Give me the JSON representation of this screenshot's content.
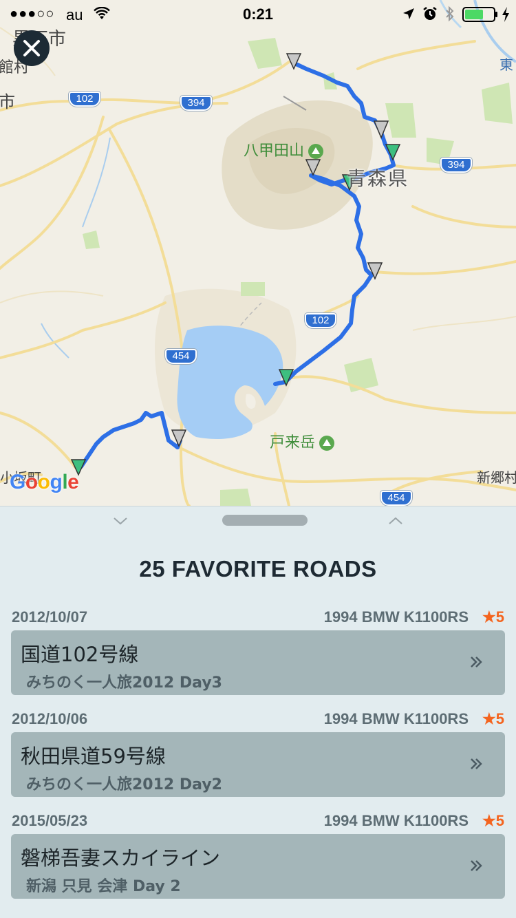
{
  "status_bar": {
    "signal": "●●●○○",
    "carrier": "au",
    "time": "0:21"
  },
  "map": {
    "labels": {
      "city_top_left": "黒石市",
      "city_left_partial": "館村",
      "city_left_partial2": "市",
      "peak_hakkoda": "八甲田山",
      "prefecture": "青森県",
      "peak_herai": "戸来岳",
      "town_shingo": "新郷村",
      "town_kosaka": "小坂町",
      "corner_right": "東"
    },
    "route_shields": {
      "r102_top": "102",
      "r394_mid": "394",
      "r394_right": "394",
      "r102_lake": "102",
      "r454_left": "454",
      "r454_bottom": "454"
    },
    "route_color": "#2d6fe6",
    "google_logo": {
      "letters": [
        "G",
        "o",
        "o",
        "g",
        "l",
        "e"
      ],
      "colors": [
        "#4285f4",
        "#ea4335",
        "#fbbc05",
        "#4285f4",
        "#34a853",
        "#ea4335"
      ]
    }
  },
  "panel": {
    "title": "25 FAVORITE ROADS",
    "roads": [
      {
        "date": "2012/10/07",
        "bike": "1994 BMW K1100RS",
        "rating": "★5",
        "name": "国道102号線",
        "trip": "みちのく一人旅2012 Day3"
      },
      {
        "date": "2012/10/06",
        "bike": "1994 BMW K1100RS",
        "rating": "★5",
        "name": "秋田県道59号線",
        "trip": "みちのく一人旅2012 Day2"
      },
      {
        "date": "2015/05/23",
        "bike": "1994 BMW K1100RS",
        "rating": "★5",
        "name": "磐梯吾妻スカイライン",
        "trip": "新潟 只見 会津 Day 2"
      }
    ]
  },
  "colors": {
    "panel_bg": "#e2ecef",
    "card_bg": "#a4b6b9",
    "accent_star": "#f4641e",
    "title_text": "#1e2a33"
  }
}
